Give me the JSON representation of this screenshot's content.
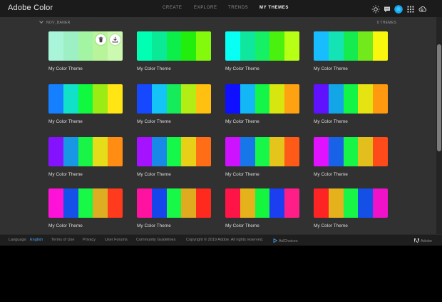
{
  "header": {
    "logo": "Adobe Color",
    "nav": [
      {
        "label": "CREATE",
        "active": false
      },
      {
        "label": "EXPLORE",
        "active": false
      },
      {
        "label": "TRENDS",
        "active": false
      },
      {
        "label": "MY THEMES",
        "active": true
      }
    ],
    "icons": [
      "sun-icon",
      "chat-icon",
      "user-avatar-icon",
      "apps-grid-icon",
      "creative-cloud-icon"
    ]
  },
  "library": {
    "folder_name": "NOV_BANER",
    "count_label": "9 THEMES"
  },
  "themes": [
    {
      "name": "My Color Theme",
      "colors": [
        "#A8F5DA",
        "#9CF0C3",
        "#A3F5A3",
        "#B8F59A",
        "#CCF9B0"
      ],
      "hovered": true
    },
    {
      "name": "My Color Theme",
      "colors": [
        "#00FFB3",
        "#0AEA96",
        "#0CEF4B",
        "#22EE0D",
        "#83F90B"
      ]
    },
    {
      "name": "My Color Theme",
      "colors": [
        "#08FFF3",
        "#0FE79F",
        "#16F065",
        "#4AF00E",
        "#B7FF15"
      ]
    },
    {
      "name": "My Color Theme",
      "colors": [
        "#18BDFF",
        "#14E4B5",
        "#15EB4F",
        "#72E91A",
        "#FAF70F"
      ]
    },
    {
      "name": "My Color Theme",
      "colors": [
        "#1580FF",
        "#11E1C9",
        "#11F93E",
        "#9BEC15",
        "#FFE513"
      ]
    },
    {
      "name": "My Color Theme",
      "colors": [
        "#1648FF",
        "#14C4F7",
        "#16EC5B",
        "#B2ED16",
        "#FFC010"
      ]
    },
    {
      "name": "My Color Theme",
      "colors": [
        "#0F10FF",
        "#13B7F5",
        "#13F549",
        "#D7E60F",
        "#FFA212"
      ]
    },
    {
      "name": "My Color Theme",
      "colors": [
        "#6012FF",
        "#12A6E6",
        "#12F547",
        "#E6E312",
        "#FF9A10"
      ]
    },
    {
      "name": "My Color Theme",
      "colors": [
        "#8512FF",
        "#1898E4",
        "#18F547",
        "#E6DD1A",
        "#FF8C13"
      ]
    },
    {
      "name": "My Color Theme",
      "colors": [
        "#A512FF",
        "#1889E6",
        "#15F84A",
        "#E8CF18",
        "#FF6E16"
      ]
    },
    {
      "name": "My Color Theme",
      "colors": [
        "#CC12FF",
        "#1777E8",
        "#16F74A",
        "#E5C41B",
        "#FF5A18"
      ]
    },
    {
      "name": "My Color Theme",
      "colors": [
        "#E012FF",
        "#1762E6",
        "#18F547",
        "#E2BF1D",
        "#FF4A1A"
      ]
    },
    {
      "name": "My Color Theme",
      "colors": [
        "#FF12D8",
        "#1550E8",
        "#18F847",
        "#DDAE21",
        "#FF3A1D"
      ]
    },
    {
      "name": "My Color Theme",
      "colors": [
        "#FF12A0",
        "#1545EB",
        "#18F847",
        "#DFAB1F",
        "#FF2A1E"
      ]
    },
    {
      "name": "My Color Theme",
      "colors": [
        "#FF1448",
        "#E5B21C",
        "#16F53E",
        "#1B3FF0",
        "#FF1E88"
      ]
    },
    {
      "name": "My Color Theme",
      "colors": [
        "#FF2424",
        "#E5B11C",
        "#18F547",
        "#1550E6",
        "#F012C8"
      ]
    }
  ],
  "footer": {
    "language_label": "Language:",
    "language_value": "English",
    "links": [
      "Terms of Use",
      "Privacy",
      "User Forums",
      "Community Guidelines"
    ],
    "copyright": "Copyright © 2019 Adobe. All rights reserved.",
    "adchoices": "AdChoices",
    "adobe": "Adobe"
  }
}
